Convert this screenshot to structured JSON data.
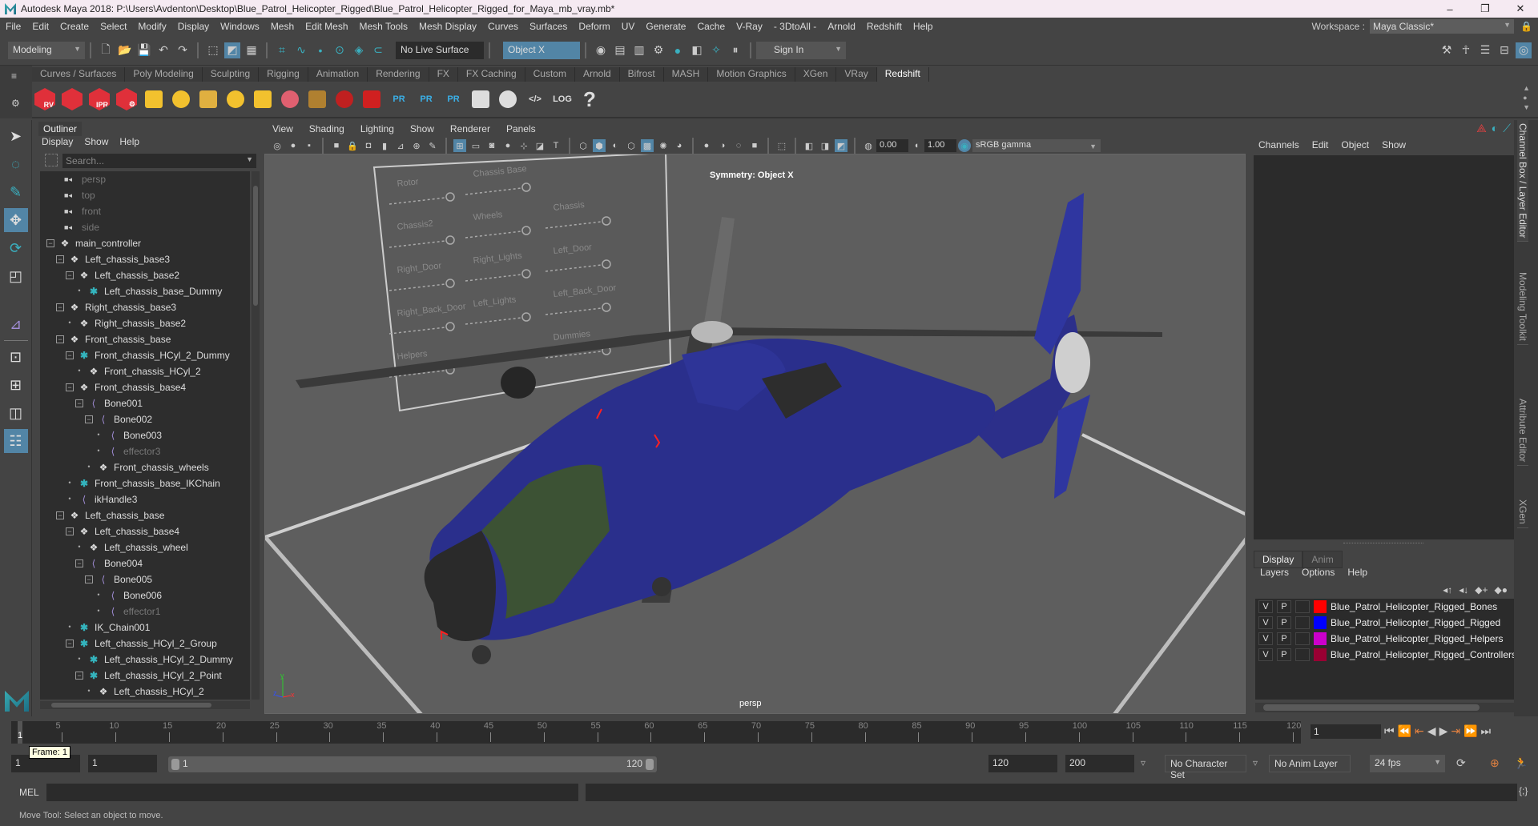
{
  "title": "Autodesk Maya 2018: P:\\Users\\Avdenton\\Desktop\\Blue_Patrol_Helicopter_Rigged\\Blue_Patrol_Helicopter_Rigged_for_Maya_mb_vray.mb*",
  "window_controls": {
    "minimize": "–",
    "maximize": "❐",
    "close": "✕"
  },
  "menubar": [
    "File",
    "Edit",
    "Create",
    "Select",
    "Modify",
    "Display",
    "Windows",
    "Mesh",
    "Edit Mesh",
    "Mesh Tools",
    "Mesh Display",
    "Curves",
    "Surfaces",
    "Deform",
    "UV",
    "Generate",
    "Cache",
    "V-Ray",
    "- 3DtoAll -",
    "Arnold",
    "Redshift",
    "Help"
  ],
  "workspace": {
    "label": "Workspace :",
    "value": "Maya Classic*"
  },
  "statusline": {
    "mode": "Modeling",
    "live_surface": "No Live Surface",
    "symmetry": "Object X",
    "sign_in": "Sign In"
  },
  "shelf_tabs": [
    "Curves / Surfaces",
    "Poly Modeling",
    "Sculpting",
    "Rigging",
    "Animation",
    "Rendering",
    "FX",
    "FX Caching",
    "Custom",
    "Arnold",
    "Bifrost",
    "MASH",
    "Motion Graphics",
    "XGen",
    "VRay",
    "Redshift"
  ],
  "active_shelf": "Redshift",
  "shelf_icons": [
    {
      "name": "rs-render-view",
      "label": "RV",
      "color": "#e0303a"
    },
    {
      "name": "rs-batch-render",
      "label": "",
      "color": "#e0303a"
    },
    {
      "name": "rs-ipr",
      "label": "IPR",
      "color": "#e0303a"
    },
    {
      "name": "rs-render-settings",
      "label": "⚙",
      "color": "#e0303a"
    },
    {
      "name": "rs-lights",
      "label": "",
      "color": "#f2c12e"
    },
    {
      "name": "rs-portal",
      "label": "",
      "color": "#f2c12e"
    },
    {
      "name": "rs-spot",
      "label": "",
      "color": "#e0b040"
    },
    {
      "name": "rs-dome",
      "label": "",
      "color": "#f2c12e"
    },
    {
      "name": "rs-sun-sky",
      "label": "",
      "color": "#f2c12e"
    },
    {
      "name": "rs-proxy",
      "label": "",
      "color": "#e06070"
    },
    {
      "name": "rs-hair",
      "label": "",
      "color": "#b08030"
    },
    {
      "name": "rs-volume",
      "label": "",
      "color": "#c02020"
    },
    {
      "name": "rs-sphere",
      "label": "",
      "color": "#d02020"
    },
    {
      "name": "pr-1",
      "label": "PR",
      "color": "#3ab0e8"
    },
    {
      "name": "pr-2",
      "label": "PR",
      "color": "#3ab0e8"
    },
    {
      "name": "pr-3",
      "label": "PR",
      "color": "#3ab0e8"
    },
    {
      "name": "pie-1",
      "label": "",
      "color": "#ddd"
    },
    {
      "name": "pie-2",
      "label": "",
      "color": "#ddd"
    },
    {
      "name": "code",
      "label": "</>",
      "color": "#ddd"
    },
    {
      "name": "log",
      "label": "LOG",
      "color": "#ddd"
    },
    {
      "name": "help",
      "label": "?",
      "color": "#ddd"
    }
  ],
  "outliner": {
    "title": "Outliner",
    "menus": [
      "Display",
      "Show",
      "Help"
    ],
    "search_placeholder": "Search...",
    "items": [
      {
        "label": "persp",
        "type": "cam",
        "depth": 0,
        "dim": true
      },
      {
        "label": "top",
        "type": "cam",
        "depth": 0,
        "dim": true
      },
      {
        "label": "front",
        "type": "cam",
        "depth": 0,
        "dim": true
      },
      {
        "label": "side",
        "type": "cam",
        "depth": 0,
        "dim": true
      },
      {
        "label": "main_controller",
        "type": "grp",
        "depth": 0,
        "exp": true
      },
      {
        "label": "Left_chassis_base3",
        "type": "grp",
        "depth": 1,
        "exp": true
      },
      {
        "label": "Left_chassis_base2",
        "type": "grp",
        "depth": 2,
        "exp": true
      },
      {
        "label": "Left_chassis_base_Dummy",
        "type": "ast",
        "depth": 3
      },
      {
        "label": "Right_chassis_base3",
        "type": "grp",
        "depth": 1,
        "exp": true
      },
      {
        "label": "Right_chassis_base2",
        "type": "grp",
        "depth": 2
      },
      {
        "label": "Front_chassis_base",
        "type": "grp",
        "depth": 1,
        "exp": true
      },
      {
        "label": "Front_chassis_HCyl_2_Dummy",
        "type": "ast",
        "depth": 2,
        "exp": true
      },
      {
        "label": "Front_chassis_HCyl_2",
        "type": "grp",
        "depth": 3
      },
      {
        "label": "Front_chassis_base4",
        "type": "grp",
        "depth": 2,
        "exp": true
      },
      {
        "label": "Bone001",
        "type": "bone",
        "depth": 3,
        "exp": true
      },
      {
        "label": "Bone002",
        "type": "bone",
        "depth": 4,
        "exp": true
      },
      {
        "label": "Bone003",
        "type": "bone",
        "depth": 5
      },
      {
        "label": "effector3",
        "type": "bone",
        "depth": 5,
        "dim": true
      },
      {
        "label": "Front_chassis_wheels",
        "type": "grp",
        "depth": 4
      },
      {
        "label": "Front_chassis_base_IKChain",
        "type": "ast",
        "depth": 2
      },
      {
        "label": "ikHandle3",
        "type": "bone",
        "depth": 2
      },
      {
        "label": "Left_chassis_base",
        "type": "grp",
        "depth": 1,
        "exp": true
      },
      {
        "label": "Left_chassis_base4",
        "type": "grp",
        "depth": 2,
        "exp": true
      },
      {
        "label": "Left_chassis_wheel",
        "type": "grp",
        "depth": 3
      },
      {
        "label": "Bone004",
        "type": "bone",
        "depth": 3,
        "exp": true
      },
      {
        "label": "Bone005",
        "type": "bone",
        "depth": 4,
        "exp": true
      },
      {
        "label": "Bone006",
        "type": "bone",
        "depth": 5
      },
      {
        "label": "effector1",
        "type": "bone",
        "depth": 5,
        "dim": true
      },
      {
        "label": "IK_Chain001",
        "type": "ast",
        "depth": 2
      },
      {
        "label": "Left_chassis_HCyl_2_Group",
        "type": "ast",
        "depth": 2,
        "exp": true
      },
      {
        "label": "Left_chassis_HCyl_2_Dummy",
        "type": "ast",
        "depth": 3
      },
      {
        "label": "Left_chassis_HCyl_2_Point",
        "type": "ast",
        "depth": 3,
        "exp": true
      },
      {
        "label": "Left_chassis_HCyl_2",
        "type": "grp",
        "depth": 4
      }
    ]
  },
  "viewport": {
    "menus": [
      "View",
      "Shading",
      "Lighting",
      "Show",
      "Renderer",
      "Panels"
    ],
    "exposure": "0.00",
    "gamma": "1.00",
    "color_space": "sRGB gamma",
    "symmetry_label": "Symmetry: Object X",
    "camera_label": "persp",
    "control_panel_labels": [
      "Rotor",
      "Chassis Base",
      "Chassis",
      "Chassis2",
      "Wheels",
      "Left_Door",
      "Right_Door",
      "Right_Lights",
      "Left_Back_Door",
      "Right_Back_Door",
      "Left_Lights",
      "Dummies",
      "Helpers"
    ]
  },
  "channel_box": {
    "menus": [
      "Channels",
      "Edit",
      "Object",
      "Show"
    ]
  },
  "layer_editor": {
    "tabs": [
      "Display",
      "Anim"
    ],
    "menus": [
      "Layers",
      "Options",
      "Help"
    ],
    "layers": [
      {
        "v": "V",
        "p": "P",
        "color": "#ff0000",
        "name": "Blue_Patrol_Helicopter_Rigged_Bones"
      },
      {
        "v": "V",
        "p": "P",
        "color": "#0000ff",
        "name": "Blue_Patrol_Helicopter_Rigged_Rigged"
      },
      {
        "v": "V",
        "p": "P",
        "color": "#cc00cc",
        "name": "Blue_Patrol_Helicopter_Rigged_Helpers"
      },
      {
        "v": "V",
        "p": "P",
        "color": "#990033",
        "name": "Blue_Patrol_Helicopter_Rigged_Controllers"
      }
    ]
  },
  "side_tabs": [
    "Channel Box / Layer Editor",
    "Modeling Toolkit",
    "Attribute Editor",
    "XGen"
  ],
  "timeline": {
    "ticks": [
      5,
      10,
      15,
      20,
      25,
      30,
      35,
      40,
      45,
      50,
      55,
      60,
      65,
      70,
      75,
      80,
      85,
      90,
      95,
      100,
      105,
      110,
      115,
      120
    ],
    "start": 1,
    "end": 120,
    "current_frame": "1",
    "current_frame_label": "1",
    "tooltip": "Frame: 1"
  },
  "range": {
    "start": "1",
    "anim_start": "1",
    "range_start": "1",
    "range_end": "120",
    "end": "120",
    "anim_end": "200",
    "character_set": "No Character Set",
    "anim_layer": "No Anim Layer",
    "fps": "24 fps"
  },
  "command_line": {
    "label": "MEL"
  },
  "help_line": "Move Tool: Select an object to move."
}
